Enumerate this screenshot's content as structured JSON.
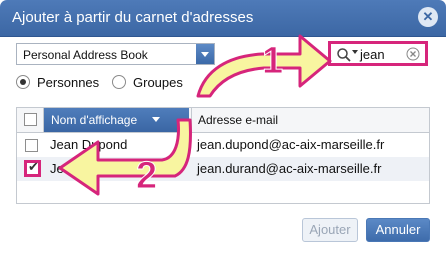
{
  "dialog": {
    "title": "Ajouter à partir du carnet d'adresses",
    "close_icon": "close-icon"
  },
  "address_book_select": {
    "value": "Personal Address Book"
  },
  "search": {
    "value": "jean",
    "icon": "search-icon",
    "clear_icon": "clear-icon"
  },
  "filter": {
    "options": [
      "Personnes",
      "Groupes"
    ],
    "selected": "Personnes"
  },
  "table": {
    "headers": [
      "Nom d'affichage",
      "Adresse e-mail"
    ],
    "rows": [
      {
        "name": "Jean Dupond",
        "email": "jean.dupond@ac-aix-marseille.fr",
        "checked": false
      },
      {
        "name": "Jean Durand",
        "email": "jean.durand@ac-aix-marseille.fr",
        "checked": true
      }
    ]
  },
  "buttons": {
    "add": "Ajouter",
    "cancel": "Annuler"
  },
  "annotations": {
    "step1": "1",
    "step2": "2",
    "accent_color": "#d6257b",
    "arrow_fill": "#f8f5a0"
  }
}
